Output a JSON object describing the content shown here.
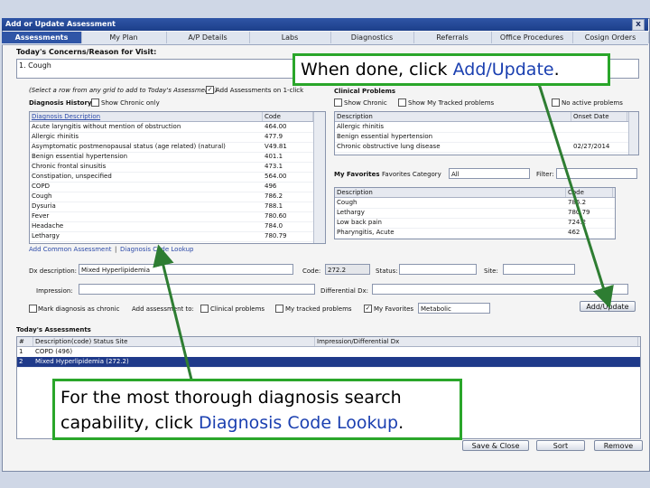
{
  "window": {
    "title": "Add or Update Assessment",
    "close_label": "x"
  },
  "tabs": [
    "Assessments",
    "My Plan",
    "A/P Details",
    "Labs",
    "Diagnostics",
    "Referrals",
    "Office Procedures",
    "Cosign Orders"
  ],
  "concerns": {
    "label": "Today's Concerns/Reason for Visit:",
    "value": "1. Cough"
  },
  "select_hint": "(Select a row from any grid to add to Today's Assessments)",
  "add_assessments_label": "Add Assessments on 1-click",
  "diagnosis_history_label": "Diagnosis History",
  "show_chronic_only_label": "Show Chronic only",
  "diagnosis_grid": {
    "headers": [
      "Diagnosis Description",
      "Code"
    ],
    "rows": [
      [
        "Acute laryngitis without mention of obstruction",
        "464.00"
      ],
      [
        "Allergic rhinitis",
        "477.9"
      ],
      [
        "Asymptomatic postmenopausal status (age related) (natural)",
        "V49.81"
      ],
      [
        "Benign essential hypertension",
        "401.1"
      ],
      [
        "Chronic frontal sinusitis",
        "473.1"
      ],
      [
        "Constipation, unspecified",
        "564.00"
      ],
      [
        "COPD",
        "496"
      ],
      [
        "Cough",
        "786.2"
      ],
      [
        "Dysuria",
        "788.1"
      ],
      [
        "Fever",
        "780.60"
      ],
      [
        "Headache",
        "784.0"
      ],
      [
        "Lethargy",
        "780.79"
      ]
    ]
  },
  "add_common_link": "Add Common Assessment",
  "diag_lookup_link": "Diagnosis Code Lookup",
  "link_separator": "|",
  "clinical_problems": {
    "label": "Clinical Problems",
    "show_chronic_label": "Show Chronic",
    "show_tracked_label": "Show My Tracked problems",
    "no_active_label": "No active problems",
    "headers": [
      "Description",
      "Onset Date"
    ],
    "rows": [
      [
        "Allergic rhinitis",
        ""
      ],
      [
        "Benign essential hypertension",
        ""
      ],
      [
        "Chronic obstructive lung disease",
        "02/27/2014"
      ]
    ]
  },
  "favorites": {
    "label": "My Favorites",
    "category_label": "Favorites Category",
    "category_value": "All",
    "filter_label": "Filter:",
    "headers": [
      "Description",
      "Code"
    ],
    "rows": [
      [
        "Cough",
        "786.2"
      ],
      [
        "Lethargy",
        "780.79"
      ],
      [
        "Low back pain",
        "724.2"
      ],
      [
        "Pharyngitis, Acute",
        "462"
      ]
    ]
  },
  "dx_form": {
    "desc_label": "Dx description:",
    "desc_value": "Mixed Hyperlipidemia",
    "code_label": "Code:",
    "code_value": "272.2",
    "status_label": "Status:",
    "site_label": "Site:",
    "impression_label": "Impression:",
    "differential_label": "Differential Dx:",
    "mark_chronic_label": "Mark diagnosis as chronic",
    "add_to_label": "Add assessment to:",
    "clinical_problems_label": "Clinical problems",
    "tracked_label": "My tracked problems",
    "favorites_label": "My Favorites",
    "favorites_value": "Metabolic",
    "add_update_label": "Add/Update"
  },
  "todays": {
    "label": "Today's Assessments",
    "headers": [
      "#",
      "Description(code) Status Site",
      "Impression/Differential Dx"
    ],
    "rows": [
      [
        "1",
        "COPD (496)",
        ""
      ],
      [
        "2",
        "Mixed Hyperlipidemia (272.2)",
        ""
      ]
    ]
  },
  "bottom_buttons": [
    "Save & Close",
    "Sort",
    "Remove"
  ],
  "callout_top": {
    "prefix": "When done, click ",
    "highlight": "Add/Update",
    "suffix": "."
  },
  "callout_bottom": {
    "prefix": "For the most thorough diagnosis search capability, click ",
    "highlight": "Diagnosis Code Lookup",
    "suffix": "."
  },
  "colors": {
    "accent": "#2f55a6",
    "callout_border": "#2aa62a",
    "arrow": "#2e7d32",
    "highlight_text": "#1a3fb0"
  }
}
